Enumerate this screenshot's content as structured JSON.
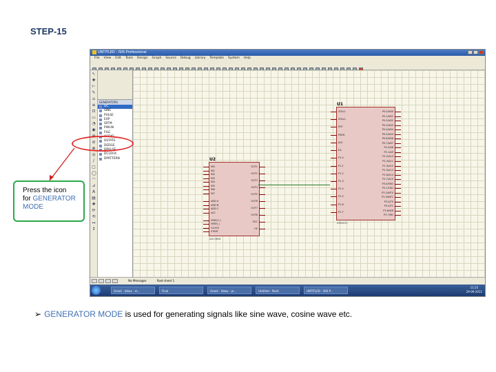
{
  "slide": {
    "title": "STEP-15"
  },
  "window": {
    "title": "UNTITLED - ISIS Professional"
  },
  "menu": [
    "File",
    "View",
    "Edit",
    "Tools",
    "Design",
    "Graph",
    "Source",
    "Debug",
    "Library",
    "Template",
    "System",
    "Help"
  ],
  "panel": {
    "mode_header": "GENERATORS",
    "items": [
      "DC",
      "SINE",
      "PULSE",
      "EXP",
      "SFFM",
      "PWLIN",
      "FILE",
      "AUDIO",
      "DSTATE",
      "DEDGE",
      "DPULSE",
      "DCLOCK",
      "DPATTERN"
    ],
    "selected": "DC"
  },
  "chip_u2": {
    "ref": "U2",
    "part": "ADC0808",
    "left_pins": [
      "IN0",
      "IN1",
      "IN2",
      "IN3",
      "IN4",
      "IN5",
      "IN6",
      "IN7",
      "",
      "ADD A",
      "ADD B",
      "ADD C",
      "ALE",
      "",
      "VREF(+)",
      "VREF(-)",
      "CLOCK",
      "START"
    ],
    "right_pins": [
      "OUT1",
      "OUT2",
      "OUT3",
      "OUT4",
      "OUT5",
      "OUT6",
      "OUT7",
      "OUT8",
      "EOC",
      "OE"
    ]
  },
  "chip_u1": {
    "ref": "U1",
    "part": "AT89C51",
    "left_pins": [
      "XTAL1",
      "XTAL2",
      "RST",
      "PSEN",
      "ALE",
      "EA",
      "P1.0",
      "P1.1",
      "P1.2",
      "P1.3",
      "P1.4",
      "P1.5",
      "P1.6",
      "P1.7"
    ],
    "right_pins": [
      "P0.0/AD0",
      "P0.1/AD1",
      "P0.2/AD2",
      "P0.3/AD3",
      "P0.4/AD4",
      "P0.5/AD5",
      "P0.6/AD6",
      "P0.7/AD7",
      "P2.0/A8",
      "P2.1/A9",
      "P2.2/A10",
      "P2.3/A11",
      "P2.4/A12",
      "P2.5/A13",
      "P2.6/A14",
      "P2.7/A15",
      "P3.0/RXD",
      "P3.1/TXD",
      "P3.2/INT0",
      "P3.3/INT1",
      "P3.4/T0",
      "P3.5/T1",
      "P3.6/WR",
      "P3.7/RD"
    ]
  },
  "status": {
    "messages": "No Messages",
    "mode": "Root sheet 1"
  },
  "taskbar": {
    "tasks": [
      "Gmail - Inbox - m...",
      "Final",
      "Gmail - Inbox - pr...",
      "Untitled - Paint",
      "UNTITLED - ISIS P..."
    ],
    "time": "11:25",
    "date": "29-09-2011"
  },
  "callout": {
    "line1": "Press the icon",
    "line2_plain": "for",
    "line2_hl": "GENERATOR",
    "line3_hl": "MODE"
  },
  "bullet": {
    "hl": "GENERATOR MODE",
    "rest": " is used for generating signals like sine wave, cosine wave etc."
  },
  "colors": {
    "callout_border": "#2aa84a",
    "ellipse": "#e03030",
    "highlight_text": "#3f6fb2",
    "chip_fill": "#e8c9c6"
  }
}
